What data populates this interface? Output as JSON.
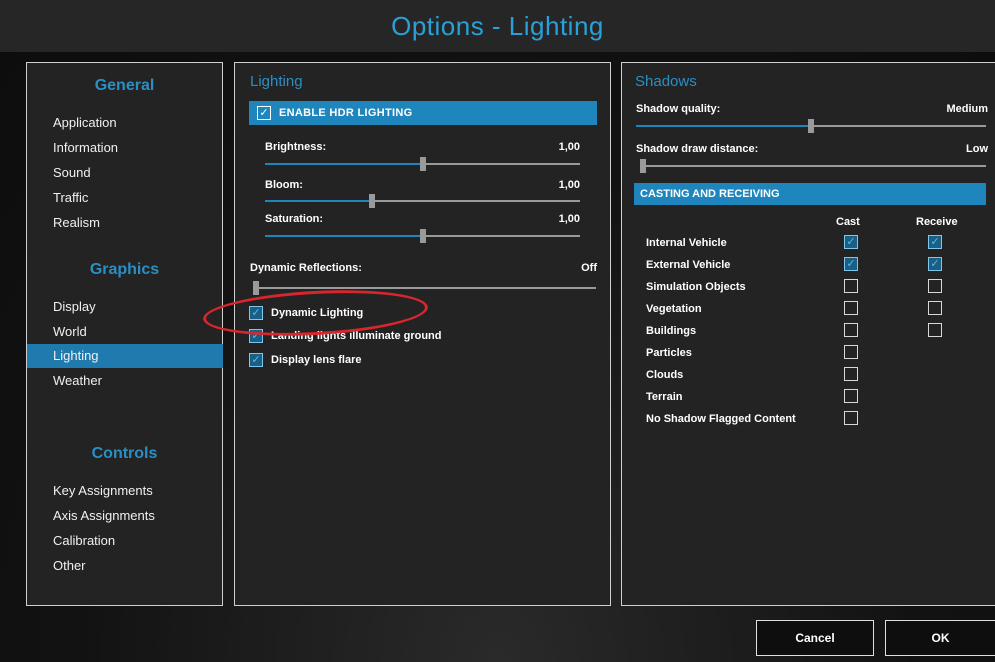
{
  "window": {
    "title": "Options - Lighting"
  },
  "sidebar": {
    "categories": [
      {
        "label": "General",
        "items": [
          "Application",
          "Information",
          "Sound",
          "Traffic",
          "Realism"
        ]
      },
      {
        "label": "Graphics",
        "items": [
          "Display",
          "World",
          "Lighting",
          "Weather"
        ]
      },
      {
        "label": "Controls",
        "items": [
          "Key Assignments",
          "Axis Assignments",
          "Calibration",
          "Other"
        ]
      }
    ],
    "active_item": "Lighting"
  },
  "lighting": {
    "title": "Lighting",
    "hdr": {
      "label": "ENABLE HDR LIGHTING",
      "checked": true
    },
    "brightness": {
      "label": "Brightness:",
      "value": "1,00",
      "level": 0.5
    },
    "bloom": {
      "label": "Bloom:",
      "value": "1,00",
      "level": 0.34
    },
    "saturation": {
      "label": "Saturation:",
      "value": "1,00",
      "level": 0.5
    },
    "dynamic_reflections": {
      "label": "Dynamic Reflections:",
      "value": "Off",
      "level": 0.0
    },
    "checks": [
      {
        "label": "Dynamic Lighting",
        "checked": true
      },
      {
        "label": "Landing lights illuminate ground",
        "checked": true
      },
      {
        "label": "Display lens flare",
        "checked": true
      }
    ]
  },
  "shadows": {
    "title": "Shadows",
    "quality": {
      "label": "Shadow quality:",
      "value": "Medium",
      "level": 0.5
    },
    "draw_distance": {
      "label": "Shadow draw distance:",
      "value": "Low",
      "level": 0.0
    },
    "casting_header": "CASTING AND RECEIVING",
    "columns": {
      "cast": "Cast",
      "receive": "Receive"
    },
    "rows": [
      {
        "name": "Internal Vehicle",
        "cast": true,
        "receive": true
      },
      {
        "name": "External Vehicle",
        "cast": true,
        "receive": true
      },
      {
        "name": "Simulation Objects",
        "cast": false,
        "receive": false
      },
      {
        "name": "Vegetation",
        "cast": false,
        "receive": false
      },
      {
        "name": "Buildings",
        "cast": false,
        "receive": false
      },
      {
        "name": "Particles",
        "cast": false
      },
      {
        "name": "Clouds",
        "cast": false
      },
      {
        "name": "Terrain",
        "cast": false
      },
      {
        "name": "No Shadow Flagged Content",
        "cast": false
      }
    ]
  },
  "footer": {
    "cancel_label": "Cancel",
    "ok_label": "OK"
  },
  "colors": {
    "accent": "#1f86bd",
    "title": "#2aa0d8",
    "annotation": "#d8262e"
  }
}
